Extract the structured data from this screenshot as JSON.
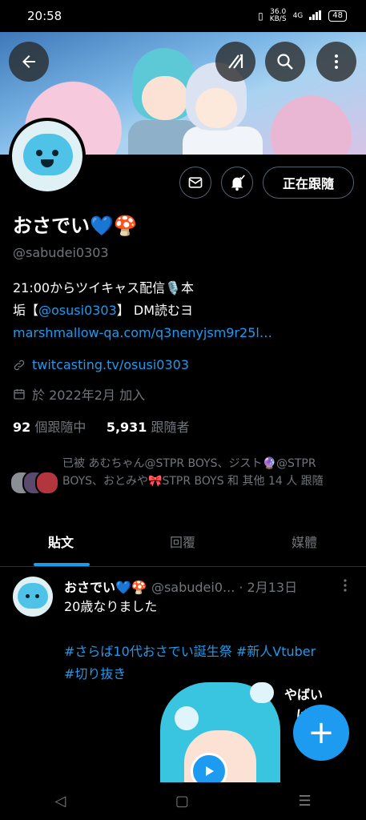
{
  "status_bar": {
    "time": "20:58",
    "net_speed": "36.0",
    "net_unit": "KB/S",
    "signal": "4G",
    "battery": "48"
  },
  "header": {
    "back_icon": "arrow-left-icon",
    "grok_icon": "grok-icon",
    "search_icon": "search-icon",
    "more_icon": "more-vertical-icon"
  },
  "profile": {
    "name": "おさでい💙🍄",
    "handle": "@sabudei0303",
    "follow_label": "正在跟隨",
    "bio_line1": "21:00からツイキャス配信🎙️本",
    "bio_line2_prefix": "垢【",
    "bio_mention": "@osusi0303",
    "bio_line2_suffix": "】 DM読むヨ",
    "bio_link": "marshmallow-qa.com/q3nenyjsm9r25l…",
    "website": "twitcasting.tv/osusi0303",
    "joined": "於 2022年2月 加入",
    "following_count": "92",
    "following_label": "個跟隨中",
    "followers_count": "5,931",
    "followers_label": "跟隨者",
    "mutuals_text": "已被 あむちゃん@STPR BOYS、ジスト🔮@STPR BOYS、おとみや🎀STPR BOYS 和 其他 14 人 跟隨"
  },
  "tabs": [
    {
      "label": "貼文",
      "active": true
    },
    {
      "label": "回覆",
      "active": false
    },
    {
      "label": "媒體",
      "active": false
    }
  ],
  "post": {
    "name": "おさでい💙🍄",
    "handle": "@sabudei0...",
    "date": "· 2月13日",
    "text1": "20歳なりました",
    "hashtags1": "#さらば10代おさでい誕生祭 #新人Vtuber",
    "hashtags2": "#切り抜き",
    "media_text1": "やばい",
    "media_text2": "ば"
  },
  "fab_label": "+",
  "navbar": {
    "back": "◁",
    "home": "▢",
    "recents": "☰"
  },
  "colors": {
    "accent": "#1d9bf0",
    "background": "#000000",
    "muted": "#71767b"
  }
}
